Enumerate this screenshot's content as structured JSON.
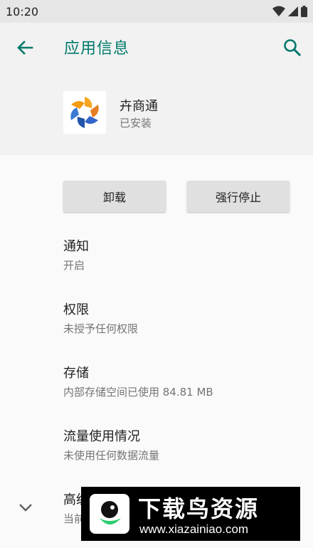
{
  "status_bar": {
    "time": "10:20",
    "icons": [
      "wifi-icon",
      "cellular-signal-icon",
      "battery-icon"
    ]
  },
  "app_bar": {
    "title": "应用信息",
    "back_icon": "arrow-back-icon",
    "search_icon": "search-icon"
  },
  "app": {
    "name": "卉商通",
    "status": "已安装"
  },
  "buttons": {
    "uninstall": "卸载",
    "force_stop": "强行停止"
  },
  "preferences": [
    {
      "title": "通知",
      "summary": "开启"
    },
    {
      "title": "权限",
      "summary": "未授予任何权限"
    },
    {
      "title": "存储",
      "summary": "内部存储空间已使用 84.81 MB"
    },
    {
      "title": "流量使用情况",
      "summary": "未使用任何数据流量"
    },
    {
      "title": "高级",
      "summary": "当前"
    }
  ],
  "watermark": {
    "title": "下载鸟资源",
    "url": "www.xiazainiao.com"
  },
  "colors": {
    "accent": "#00796b",
    "header_bg": "#f2f2f2",
    "button_bg": "#e0e0e0"
  }
}
